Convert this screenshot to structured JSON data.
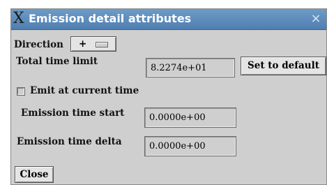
{
  "window": {
    "title": "Emission detail attributes",
    "close_glyph": "×"
  },
  "direction": {
    "label": "Direction",
    "value": "+"
  },
  "total_time_limit": {
    "label": "Total time limit",
    "value": "8.2274e+01",
    "default_button": "Set to default"
  },
  "emit_current": {
    "label": "Emit at current time",
    "checked": false
  },
  "emission_start": {
    "label": "Emission time start",
    "value": "0.0000e+00"
  },
  "emission_delta": {
    "label": "Emission time delta",
    "value": "0.0000e+00"
  },
  "close_button": {
    "label": "Close"
  }
}
